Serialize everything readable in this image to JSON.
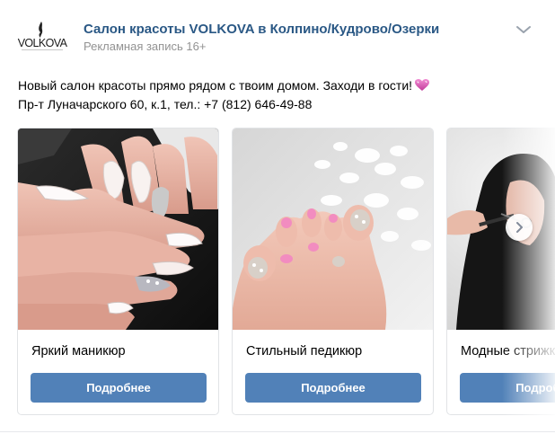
{
  "post": {
    "author": "Салон красоты VOLKOVA в Колпино/Кудрово/Озерки",
    "meta": "Рекламная запись 16+",
    "logo_text": "VOLKOVA",
    "text_line1": "Новый салон красоты прямо рядом с твоим домом. Заходи в гости!",
    "text_line2": "Пр-т Луначарского 60, к.1, тел.: +7 (812) 646-49-88",
    "icons": {
      "menu": "chevron-down-icon",
      "emoji": "sparkling-heart-icon",
      "next": "chevron-right-icon"
    }
  },
  "carousel": {
    "cards": [
      {
        "title": "Яркий маникюр",
        "button": "Подробнее",
        "photo": "manicure-photo"
      },
      {
        "title": "Стильный педикюр",
        "button": "Подробнее",
        "photo": "pedicure-photo"
      },
      {
        "title": "Модные стрижки",
        "button": "Подробнее",
        "photo": "haircut-photo"
      }
    ]
  },
  "colors": {
    "link": "#2a5885",
    "meta": "#939393",
    "button": "#5181b8",
    "border": "#e1e3e6"
  }
}
